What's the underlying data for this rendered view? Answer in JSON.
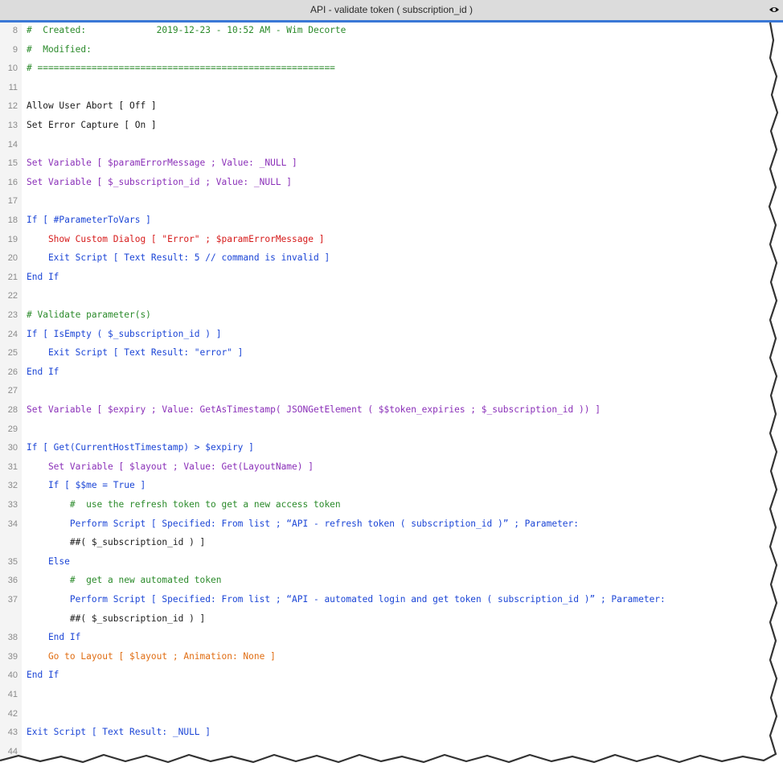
{
  "window": {
    "title": "API - validate token ( subscription_id )",
    "icon": "eye-icon"
  },
  "colors": {
    "accent": "#3a78d6",
    "black": "#1a1a1a",
    "purple": "#8a2fb8",
    "blue": "#1b45d6",
    "green": "#2a8a2a",
    "red": "#d61a1a",
    "orange": "#e06d12"
  },
  "lines": [
    {
      "num": "8",
      "text": "#  Created:             2019-12-23 - 10:52 AM - Wim Decorte",
      "color": "green"
    },
    {
      "num": "9",
      "text": "#  Modified:",
      "color": "green"
    },
    {
      "num": "10",
      "text": "# =======================================================",
      "color": "green"
    },
    {
      "num": "11",
      "text": "",
      "color": "black"
    },
    {
      "num": "12",
      "text": "Allow User Abort [ Off ]",
      "color": "black"
    },
    {
      "num": "13",
      "text": "Set Error Capture [ On ]",
      "color": "black"
    },
    {
      "num": "14",
      "text": "",
      "color": "black"
    },
    {
      "num": "15",
      "text": "Set Variable [ $paramErrorMessage ; Value: _NULL ]",
      "color": "purple"
    },
    {
      "num": "16",
      "text": "Set Variable [ $_subscription_id ; Value: _NULL ]",
      "color": "purple"
    },
    {
      "num": "17",
      "text": "",
      "color": "black"
    },
    {
      "num": "18",
      "text": "If [ #ParameterToVars ]",
      "color": "blue"
    },
    {
      "num": "19",
      "text": "    Show Custom Dialog [ \"Error\" ; $paramErrorMessage ]",
      "color": "red"
    },
    {
      "num": "20",
      "text": "    Exit Script [ Text Result: 5 // command is invalid ]",
      "color": "blue"
    },
    {
      "num": "21",
      "text": "End If",
      "color": "blue"
    },
    {
      "num": "22",
      "text": "",
      "color": "black"
    },
    {
      "num": "23",
      "text": "# Validate parameter(s)",
      "color": "green"
    },
    {
      "num": "24",
      "text": "If [ IsEmpty ( $_subscription_id ) ]",
      "color": "blue"
    },
    {
      "num": "25",
      "text": "    Exit Script [ Text Result: \"error\" ]",
      "color": "blue"
    },
    {
      "num": "26",
      "text": "End If",
      "color": "blue"
    },
    {
      "num": "27",
      "text": "",
      "color": "black"
    },
    {
      "num": "28",
      "text": "Set Variable [ $expiry ; Value: GetAsTimestamp( JSONGetElement ( $$token_expiries ; $_subscription_id )) ]",
      "color": "purple"
    },
    {
      "num": "29",
      "text": "",
      "color": "black"
    },
    {
      "num": "30",
      "text": "If [ Get(CurrentHostTimestamp) > $expiry ]",
      "color": "blue"
    },
    {
      "num": "31",
      "text": "    Set Variable [ $layout ; Value: Get(LayoutName) ]",
      "color": "purple"
    },
    {
      "num": "32",
      "text": "    If [ $$me = True ]",
      "color": "blue"
    },
    {
      "num": "33",
      "text": "        #  use the refresh token to get a new access token",
      "color": "green"
    },
    {
      "num": "34",
      "text": "        Perform Script [ Specified: From list ; “API - refresh token ( subscription_id )” ; Parameter:",
      "color": "blue"
    },
    {
      "num": "",
      "text": "        ##( $_subscription_id ) ]",
      "color": "black"
    },
    {
      "num": "35",
      "text": "    Else",
      "color": "blue"
    },
    {
      "num": "36",
      "text": "        #  get a new automated token",
      "color": "green"
    },
    {
      "num": "37",
      "text": "        Perform Script [ Specified: From list ; “API - automated login and get token ( subscription_id )” ; Parameter:",
      "color": "blue"
    },
    {
      "num": "",
      "text": "        ##( $_subscription_id ) ]",
      "color": "black"
    },
    {
      "num": "38",
      "text": "    End If",
      "color": "blue"
    },
    {
      "num": "39",
      "text": "    Go to Layout [ $layout ; Animation: None ]",
      "color": "orange"
    },
    {
      "num": "40",
      "text": "End If",
      "color": "blue"
    },
    {
      "num": "41",
      "text": "",
      "color": "black"
    },
    {
      "num": "42",
      "text": "",
      "color": "black"
    },
    {
      "num": "43",
      "text": "Exit Script [ Text Result: _NULL ]",
      "color": "blue"
    },
    {
      "num": "44",
      "text": "",
      "color": "black"
    }
  ]
}
